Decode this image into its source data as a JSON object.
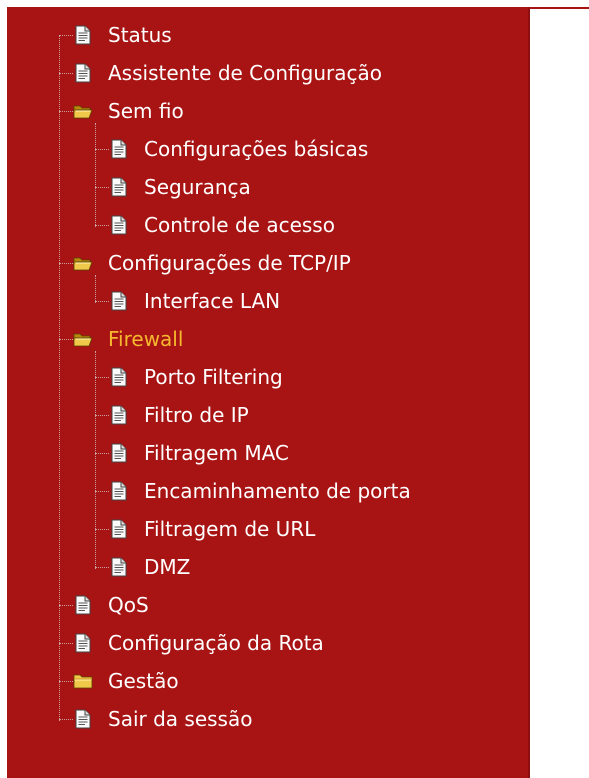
{
  "menu": {
    "status": "Status",
    "wizard": "Assistente de Configuração",
    "wireless": {
      "label": "Sem fio",
      "children": {
        "basic": "Configurações básicas",
        "security": "Segurança",
        "access_control": "Controle de acesso"
      }
    },
    "tcpip": {
      "label": "Configurações de TCP/IP",
      "children": {
        "lan": "Interface LAN"
      }
    },
    "firewall": {
      "label": "Firewall",
      "children": {
        "port_filtering": "Porto Filtering",
        "ip_filter": "Filtro de IP",
        "mac_filter": "Filtragem MAC",
        "port_forwarding": "Encaminhamento de porta",
        "url_filter": "Filtragem de URL",
        "dmz": "DMZ"
      }
    },
    "qos": "QoS",
    "route": "Configuração da Rota",
    "management": "Gestão",
    "logout": "Sair da sessão"
  },
  "colors": {
    "sidebar_bg": "#a81414",
    "text": "#ffffff",
    "active_text": "#f5b82e"
  },
  "icons": {
    "page": "page-icon",
    "folder_open": "folder-open-icon",
    "folder_closed": "folder-closed-icon"
  }
}
